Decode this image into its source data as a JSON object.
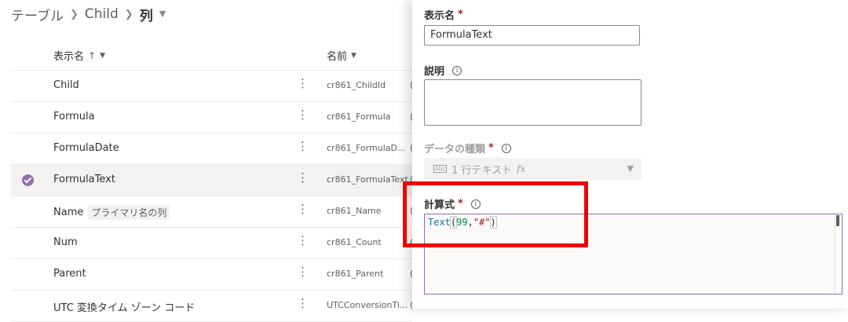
{
  "breadcrumb": {
    "tables": "テーブル",
    "table": "Child",
    "current": "列"
  },
  "columns_header": {
    "display_name": "表示名",
    "sort_icon": "↑",
    "name": "名前"
  },
  "rows": [
    {
      "display": "Child",
      "badge": "",
      "logical": "cr861_ChildId",
      "selected": false
    },
    {
      "display": "Formula",
      "badge": "",
      "logical": "cr861_Formula",
      "selected": false
    },
    {
      "display": "FormulaDate",
      "badge": "",
      "logical": "cr861_FormulaD...",
      "selected": false
    },
    {
      "display": "FormulaText",
      "badge": "",
      "logical": "cr861_FormulaText",
      "selected": true
    },
    {
      "display": "Name",
      "badge": "プライマリ名の列",
      "logical": "cr861_Name",
      "selected": false
    },
    {
      "display": "Num",
      "badge": "",
      "logical": "cr861_Count",
      "selected": false
    },
    {
      "display": "Parent",
      "badge": "",
      "logical": "cr861_Parent",
      "selected": false
    },
    {
      "display": "UTC 変換タイム ゾーン コード",
      "badge": "",
      "logical": "UTCConversionTi...",
      "selected": false
    }
  ],
  "panel": {
    "display_name_label": "表示名",
    "required_mark": "*",
    "display_name_value": "FormulaText",
    "description_label": "説明",
    "description_value": "",
    "data_type_label": "データの種類",
    "data_type_icon_text": "Abc",
    "data_type_value": "1 行テキスト",
    "data_type_fx": "fx",
    "formula_label": "計算式",
    "formula": {
      "fn": "Text",
      "open": "(",
      "num": "99",
      "comma": ",",
      "str": "\"#\"",
      "close": ")"
    }
  },
  "colors": {
    "accent": "#8f6fae",
    "required": "#a4262c",
    "highlight": "#ee0000"
  },
  "icons": [
    "chevron-right-icon",
    "chevron-down-icon",
    "sort-ascending-icon",
    "more-vertical-icon",
    "checkmark-circle-icon",
    "info-icon",
    "fx-icon"
  ]
}
